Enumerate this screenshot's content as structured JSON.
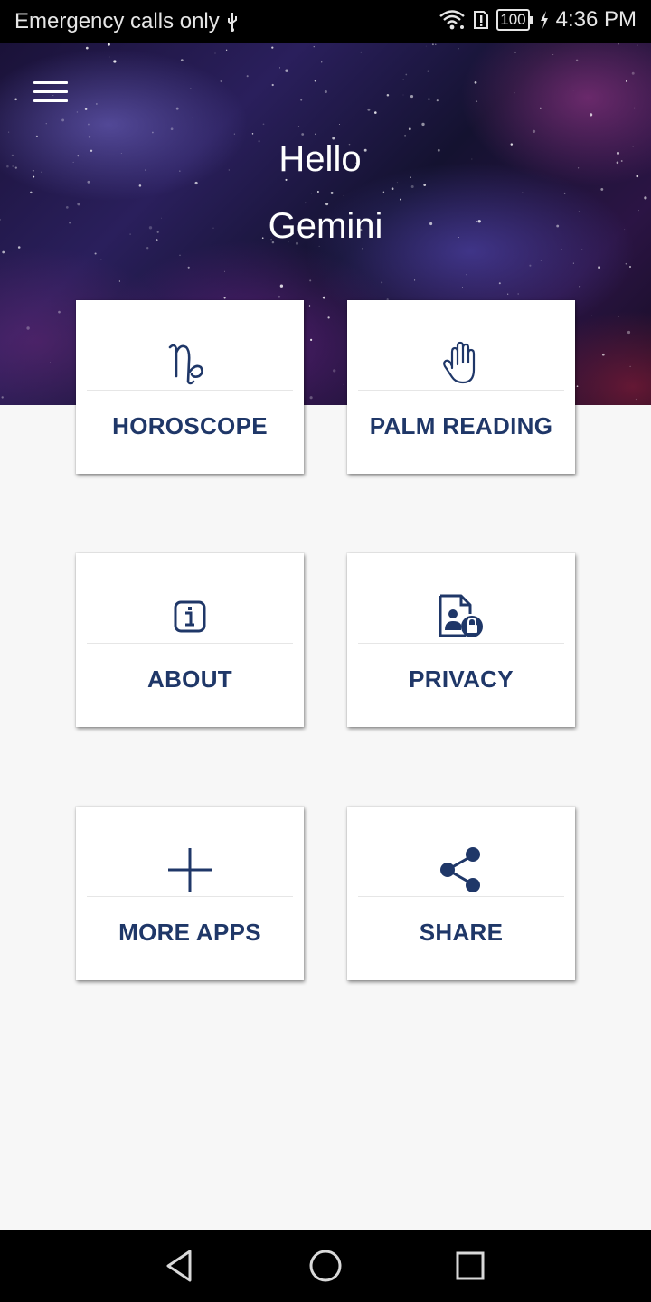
{
  "status_bar": {
    "carrier_text": "Emergency calls only",
    "battery": "100",
    "time": "4:36 PM",
    "icons": [
      "usb-icon",
      "wifi-icon",
      "sim-alert-icon",
      "battery-icon",
      "charging-icon"
    ]
  },
  "header": {
    "menu_icon": "hamburger-menu-icon",
    "greeting": "Hello",
    "sign": "Gemini"
  },
  "tiles": [
    {
      "label": "HOROSCOPE",
      "icon": "capricorn-symbol-icon"
    },
    {
      "label": "PALM READING",
      "icon": "hand-icon"
    },
    {
      "label": "ABOUT",
      "icon": "info-icon"
    },
    {
      "label": "PRIVACY",
      "icon": "privacy-document-lock-icon"
    },
    {
      "label": "MORE APPS",
      "icon": "plus-icon"
    },
    {
      "label": "SHARE",
      "icon": "share-icon"
    }
  ],
  "nav_bar": {
    "buttons": [
      "back-icon",
      "home-icon",
      "recents-icon"
    ]
  },
  "colors": {
    "accent": "#1f3768",
    "background": "#f7f7f7",
    "tile_background": "#ffffff"
  }
}
